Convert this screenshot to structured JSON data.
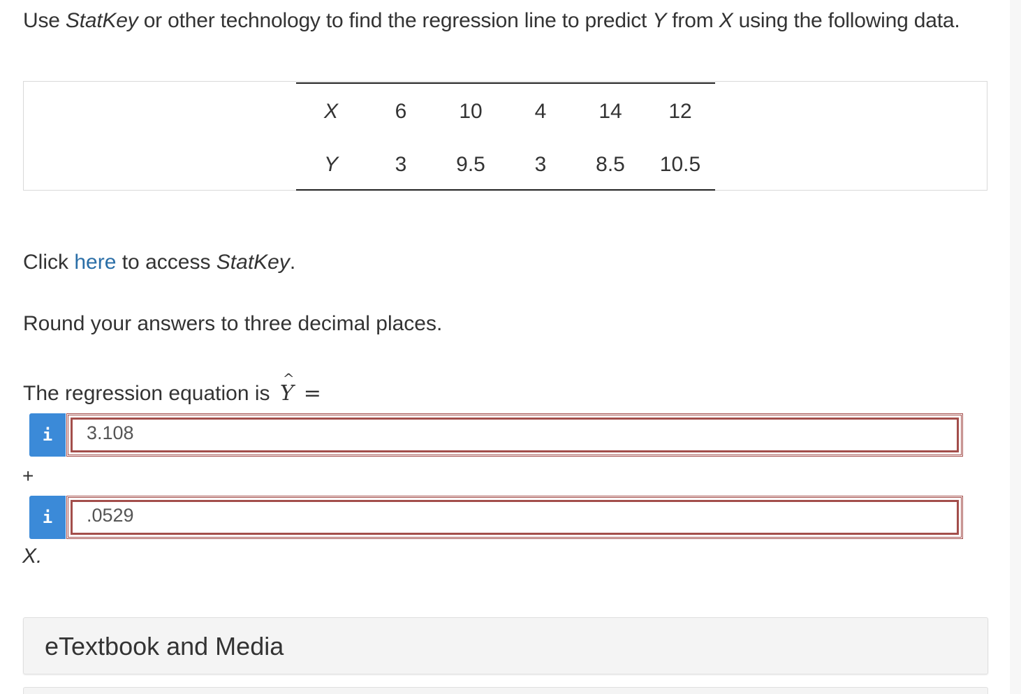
{
  "question": {
    "part1": "Use ",
    "statkey": "StatKey",
    "part2": " or other technology to find the regression line to predict ",
    "y_var": "Y",
    "part3": " from ",
    "x_var": "X",
    "part4": " using the following data."
  },
  "table": {
    "x_label": "X",
    "y_label": "Y",
    "x_values": [
      "6",
      "10",
      "4",
      "14",
      "12"
    ],
    "y_values": [
      "3",
      "9.5",
      "3",
      "8.5",
      "10.5"
    ]
  },
  "access": {
    "prefix": "Click ",
    "link_text": "here",
    "middle": " to access ",
    "statkey": "StatKey",
    "suffix": "."
  },
  "round_instruction": "Round your answers to three decimal places.",
  "equation": {
    "prefix": "The regression equation is ",
    "y_hat": "Y",
    "hat": "^",
    "equals": "="
  },
  "answers": {
    "intercept_value": "3.108",
    "slope_value": ".0529",
    "info_icon": "i",
    "plus": "+",
    "x_suffix": "X."
  },
  "etextbook": {
    "label": "eTextbook and Media"
  },
  "colors": {
    "link": "#2a6ea7",
    "info_button": "#3b8ad8",
    "answer_border": "#a34e4b"
  }
}
